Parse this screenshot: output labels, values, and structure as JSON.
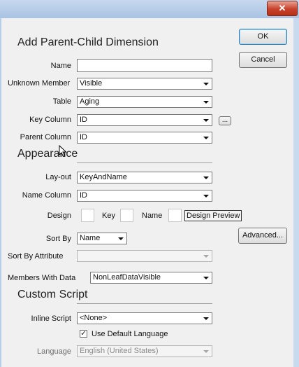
{
  "window": {
    "close_glyph": "✕"
  },
  "buttons": {
    "ok": "OK",
    "cancel": "Cancel",
    "advanced": "Advanced...",
    "browse": "..."
  },
  "sections": {
    "main_title": "Add Parent-Child Dimension",
    "appearance": "Appearance",
    "custom_script": "Custom Script"
  },
  "fields": {
    "name": {
      "label": "Name",
      "value": ""
    },
    "unknown_member": {
      "label": "Unknown Member",
      "value": "Visible"
    },
    "table": {
      "label": "Table",
      "value": "Aging"
    },
    "key_column": {
      "label": "Key Column",
      "value": "ID"
    },
    "parent_column": {
      "label": "Parent Column",
      "value": "ID"
    },
    "layout": {
      "label": "Lay-out",
      "value": "KeyAndName"
    },
    "name_column": {
      "label": "Name Column",
      "value": "ID"
    },
    "design": {
      "label": "Design",
      "key_label": "Key",
      "name_label": "Name",
      "preview_label": "Design Preview"
    },
    "sort_by": {
      "label": "Sort By",
      "value": "Name"
    },
    "sort_by_attribute": {
      "label": "Sort By Attribute",
      "value": ""
    },
    "members_with_data": {
      "label": "Members With Data",
      "value": "NonLeafDataVisible"
    },
    "inline_script": {
      "label": "Inline Script",
      "value": "<None>"
    },
    "use_default_language": {
      "label": "Use Default Language",
      "checked": true,
      "check_glyph": "✓"
    },
    "language": {
      "label": "Language",
      "value": "English (United States)"
    }
  },
  "colors": {
    "titlebar": "#a9c3e3",
    "close_button": "#c8412b",
    "dialog_bg": "#f0f0f0"
  },
  "icons": [
    "close-icon",
    "dropdown-arrow-icon",
    "mouse-cursor-icon"
  ]
}
